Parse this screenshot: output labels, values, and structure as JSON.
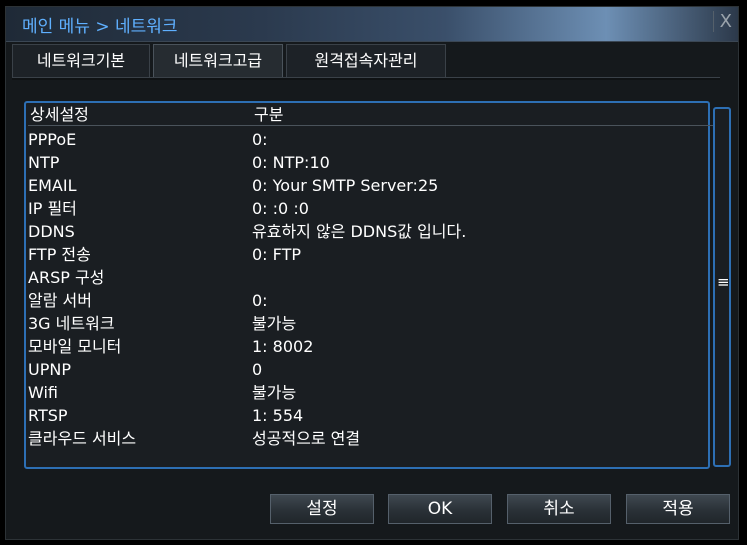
{
  "window": {
    "title": "메인 메뉴 > 네트워크",
    "close_label": "X"
  },
  "tabs": [
    {
      "label": "네트워크기본",
      "active": false
    },
    {
      "label": "네트워크고급",
      "active": true
    },
    {
      "label": "원격접속자관리",
      "active": false
    }
  ],
  "list": {
    "header": {
      "col1": "상세설정",
      "col2": "구분"
    },
    "rows": [
      {
        "name": "PPPoE",
        "value": "0:"
      },
      {
        "name": "NTP",
        "value": "0: NTP:10"
      },
      {
        "name": "EMAIL",
        "value": "0: Your SMTP Server:25"
      },
      {
        "name": "IP 필터",
        "value": "0: :0 :0"
      },
      {
        "name": "DDNS",
        "value": "유효하지 않은 DDNS값 입니다."
      },
      {
        "name": "FTP 전송",
        "value": "0: FTP"
      },
      {
        "name": "ARSP 구성",
        "value": ""
      },
      {
        "name": "알람 서버",
        "value": "0:"
      },
      {
        "name": "3G 네트워크",
        "value": "불가능"
      },
      {
        "name": "모바일 모니터",
        "value": "1: 8002"
      },
      {
        "name": "UPNP",
        "value": "0"
      },
      {
        "name": "Wifi",
        "value": "불가능"
      },
      {
        "name": "RTSP",
        "value": "1: 554"
      },
      {
        "name": "클라우드 서비스",
        "value": "성공적으로 연결"
      }
    ]
  },
  "scrollbar": {
    "thumb_icon": "≡"
  },
  "buttons": {
    "setup": "설정",
    "ok": "OK",
    "cancel": "취소",
    "apply": "적용"
  },
  "colors": {
    "accent": "#2d6fb4",
    "title_text": "#5fb0ff"
  }
}
